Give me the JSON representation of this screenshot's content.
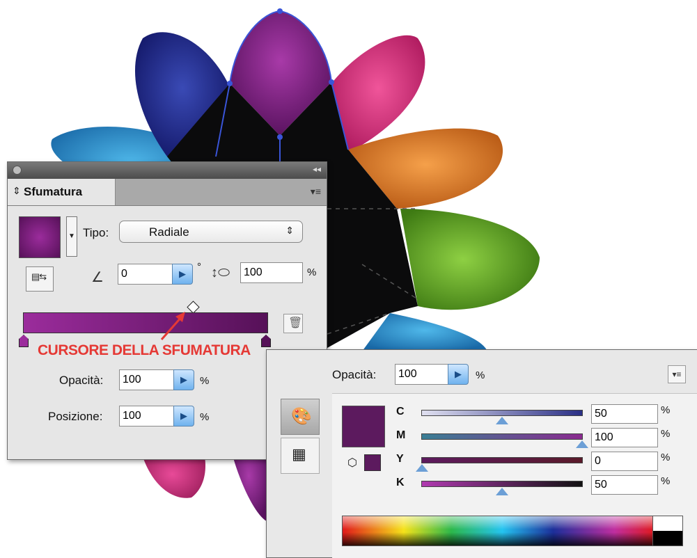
{
  "artwork": {
    "petal_colors": [
      "#1e2a8a",
      "#8b2a8f",
      "#e8408a",
      "#e98b3a",
      "#78c13a",
      "#3aa3dc",
      "#d83a8c",
      "#7a2a8a"
    ]
  },
  "annotation": {
    "label": "CURSORE DELLA SFUMATURA",
    "color": "#e53935"
  },
  "gradient_panel": {
    "tab_label": "Sfumatura",
    "type_label": "Tipo:",
    "type_value": "Radiale",
    "angle_value": "0",
    "degree_symbol": "°",
    "aspect_value": "100",
    "aspect_unit": "%",
    "gradient_colors": [
      "#9b2c9c",
      "#561158"
    ],
    "opacity_label": "Opacità:",
    "opacity_value": "100",
    "opacity_unit": "%",
    "position_label": "Posizione:",
    "position_value": "100",
    "position_unit": "%"
  },
  "color_panel": {
    "opacity_label": "Opacità:",
    "opacity_value": "100",
    "opacity_unit": "%",
    "swatch_color": "#5c1a5e",
    "channels": [
      {
        "name": "C",
        "value": "50",
        "unit": "%",
        "level": 0.5,
        "track": [
          "#e0e0f0",
          "#2a2f85"
        ]
      },
      {
        "name": "M",
        "value": "100",
        "unit": "%",
        "level": 1.0,
        "track": [
          "#3a7f95",
          "#8a2a8f"
        ]
      },
      {
        "name": "Y",
        "value": "0",
        "unit": "%",
        "level": 0.0,
        "track": [
          "#5c1a5e",
          "#5a1a2a"
        ]
      },
      {
        "name": "K",
        "value": "50",
        "unit": "%",
        "level": 0.5,
        "track": [
          "#b03ab0",
          "#111111"
        ]
      }
    ]
  }
}
